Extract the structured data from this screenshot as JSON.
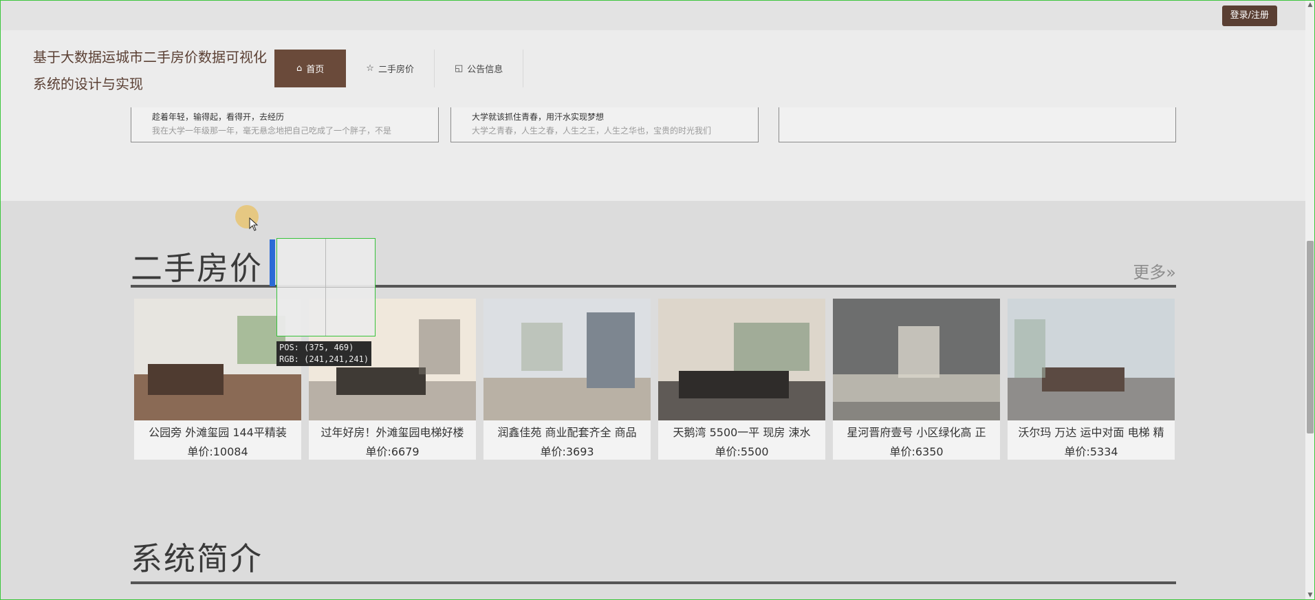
{
  "header": {
    "login_label": "登录/注册",
    "site_title": "基于大数据运城市二手房价数据可视化系统的设计与实现",
    "nav": [
      {
        "label": "首页",
        "icon": "home-icon"
      },
      {
        "label": "二手房价",
        "icon": "star-icon"
      },
      {
        "label": "公告信息",
        "icon": "bag-icon"
      }
    ]
  },
  "notices": [
    {
      "title": "趁着年轻，输得起，看得开，去经历",
      "desc": "我在大学一年级那一年，毫无悬念地把自己吃成了一个胖子，不是"
    },
    {
      "title": "大学就该抓住青春，用汗水实现梦想",
      "desc": "大学之青春，人生之春，人生之王，人生之华也，宝贵的时光我们"
    },
    {
      "title": "",
      "desc": ""
    }
  ],
  "sections": {
    "housing_title": "二手房价",
    "more_label": "更多»",
    "intro_title": "系统简介"
  },
  "listings": [
    {
      "title": "公园旁 外滩玺园 144平精装",
      "price": "单价:10084",
      "photo_colors": [
        "#e7e5e0",
        "#8a6a55",
        "#4f3b30"
      ]
    },
    {
      "title": "过年好房！外滩玺园电梯好楼",
      "price": "单价:6679",
      "photo_colors": [
        "#f0e8dc",
        "#b8b0a6",
        "#3f3a35"
      ]
    },
    {
      "title": "润鑫佳苑 商业配套齐全 商品",
      "price": "单价:3693",
      "photo_colors": [
        "#dcdfe3",
        "#7d8690",
        "#b9b1a5"
      ]
    },
    {
      "title": "天鹅湾 5500一平 现房 涑水",
      "price": "单价:5500",
      "photo_colors": [
        "#ddd6cb",
        "#5f5a56",
        "#2f2c2a"
      ]
    },
    {
      "title": "星河晋府壹号 小区绿化高 正",
      "price": "单价:6350",
      "photo_colors": [
        "#6d6e6e",
        "#b8b5ac",
        "#3e3f3f"
      ]
    },
    {
      "title": "沃尔玛 万达 运中对面 电梯 精",
      "price": "单价:5334",
      "photo_colors": [
        "#cfd6da",
        "#8f8d8b",
        "#5b4a42"
      ]
    }
  ],
  "overlay": {
    "pos_text": "POS: (375, 469)",
    "rgb_text": "RGB: (241,241,241)"
  },
  "colors": {
    "accent": "#5a3f33",
    "nav_active": "#6a4a3a",
    "ruler_border": "#36c23a"
  }
}
